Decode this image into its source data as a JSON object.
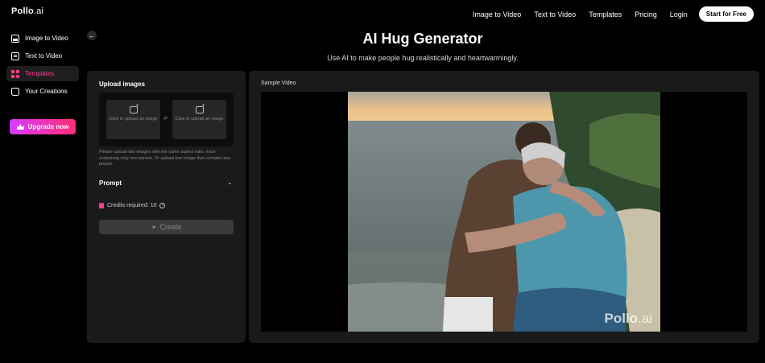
{
  "brand": {
    "name": "Pollo",
    "suffix": ".ai"
  },
  "nav": {
    "links": [
      "Image to Video",
      "Text to Video",
      "Templates",
      "Pricing",
      "Login"
    ],
    "cta": "Start for Free"
  },
  "sidebar": {
    "items": [
      {
        "label": "Image to Video",
        "icon": "image-icon"
      },
      {
        "label": "Text to Video",
        "icon": "text-icon"
      },
      {
        "label": "Templates",
        "icon": "grid-icon"
      },
      {
        "label": "Your Creations",
        "icon": "folder-icon"
      }
    ],
    "upgrade": "Upgrade now"
  },
  "page": {
    "title": "AI Hug Generator",
    "subtitle": "Use AI to make people hug realistically and heartwarmingly."
  },
  "form": {
    "upload_label": "Upload images",
    "slot1": "Click to upload an image",
    "slot2": "Click to upload an image",
    "note": "Please upload two images with the same aspect ratio, each containing only one person. Or upload one image that contains two people.",
    "prompt_label": "Prompt",
    "credits": "Credits required: 10",
    "create": "Create"
  },
  "preview": {
    "label": "Sample Video",
    "watermark": "Pollo",
    "watermark_suffix": ".ai"
  },
  "colors": {
    "accent": "#ff3a8c",
    "upgrade_start": "#d63cff",
    "upgrade_end": "#ff2d74"
  }
}
